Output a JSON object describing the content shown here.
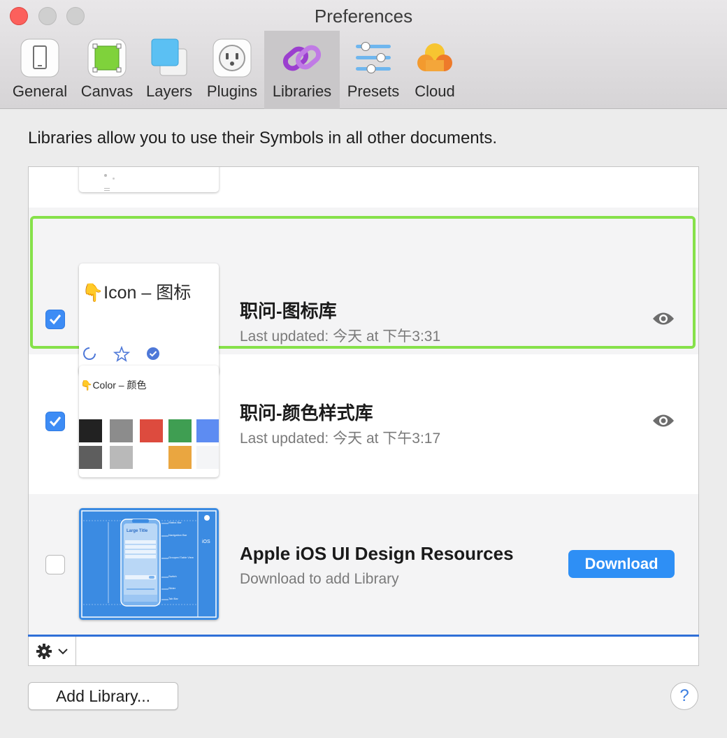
{
  "window": {
    "title": "Preferences"
  },
  "tabs": [
    {
      "label": "General",
      "icon": "general-icon"
    },
    {
      "label": "Canvas",
      "icon": "canvas-icon"
    },
    {
      "label": "Layers",
      "icon": "layers-icon"
    },
    {
      "label": "Plugins",
      "icon": "plugins-icon"
    },
    {
      "label": "Libraries",
      "icon": "libraries-icon",
      "active": true
    },
    {
      "label": "Presets",
      "icon": "presets-icon"
    },
    {
      "label": "Cloud",
      "icon": "cloud-icon"
    }
  ],
  "intro": "Libraries allow you to use their Symbols in all other documents.",
  "libraries": [
    {
      "thumb_title": "Icon – 图标",
      "name": "职问-图标库",
      "subtitle": "Last updated: 今天 at 下午3:31",
      "checked": true,
      "selected": true
    },
    {
      "thumb_title": "Color – 颜色",
      "name": "职问-颜色样式库",
      "subtitle": "Last updated: 今天 at 下午3:17",
      "checked": true,
      "swatches": [
        "#222222",
        "#8c8c8c",
        "#dd4b3e",
        "#3f9e52",
        "#5d8cf2",
        "#5e5e5e",
        "#b9b9b9",
        "#ffffff",
        "#eaa640",
        "#f4f5f7"
      ]
    },
    {
      "name": "Apple iOS UI Design Resources",
      "subtitle": "Download to add Library",
      "checked": false,
      "button": "Download",
      "thumb_text": {
        "large_title": "Large Title",
        "ios": "iOS",
        "status_bar": "Status Bar",
        "navigation_bar": "Navigation Bar",
        "grouped_table_view": "Grouped Table View",
        "switch": "Switch",
        "slider": "Slider",
        "tab_bar": "Tab Bar"
      }
    }
  ],
  "footer": {
    "add_library": "Add Library...",
    "help": "?"
  },
  "colors": {
    "accent_blue": "#2e8ff5",
    "selection_green": "#86e14a",
    "checkbox_blue": "#3d8cf5"
  }
}
